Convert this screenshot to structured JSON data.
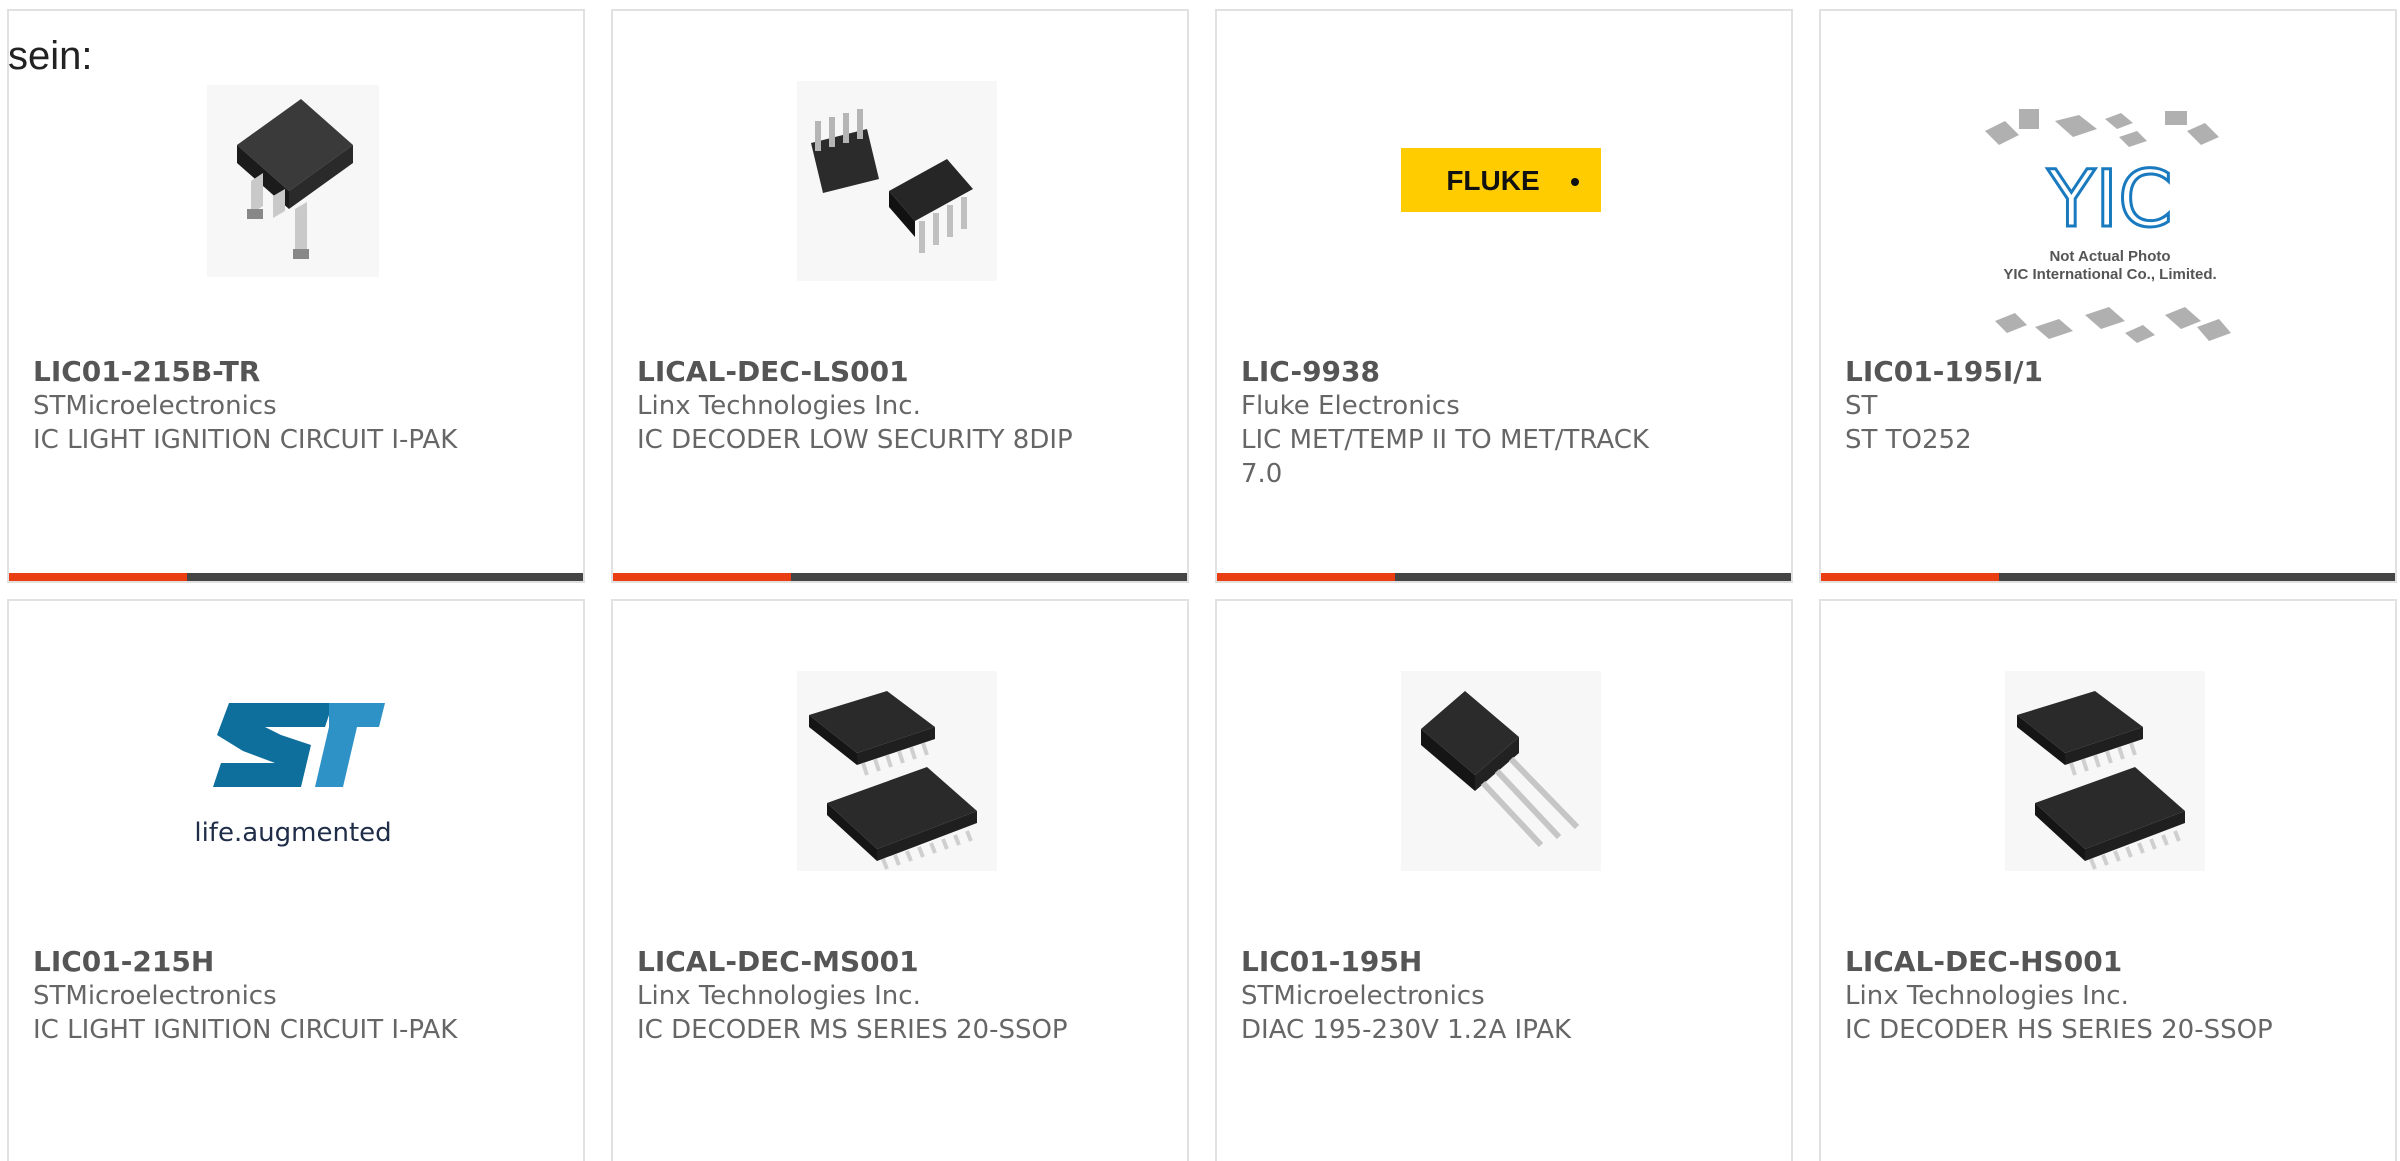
{
  "intro_text": "sein:",
  "colors": {
    "accent": "#e83e12",
    "track": "#444444",
    "card_border": "#e1e1e1",
    "text": "#666666"
  },
  "products": [
    {
      "part_number": "LIC01-215B-TR",
      "manufacturer": "STMicroelectronics",
      "description": "IC LIGHT IGNITION CIRCUIT I-PAK",
      "image": "dpak-package-icon",
      "progress_fraction": 0.31
    },
    {
      "part_number": "LICAL-DEC-LS001",
      "manufacturer": "Linx Technologies Inc.",
      "description": "IC DECODER LOW SECURITY 8DIP",
      "image": "dip-package-icon",
      "progress_fraction": 0.31
    },
    {
      "part_number": "LIC-9938",
      "manufacturer": "Fluke Electronics",
      "description": "LIC MET/TEMP II TO MET/TRACK 7.0",
      "image": "fluke-logo",
      "image_text": "FLUKE",
      "progress_fraction": 0.31
    },
    {
      "part_number": "LIC01-195I/1",
      "manufacturer": "ST",
      "description": "ST TO252",
      "image": "yic-placeholder",
      "image_text_line1": "Not Actual Photo",
      "image_text_line2": "YIC International Co., Limited.",
      "image_logo": "YIC",
      "progress_fraction": 0.31
    },
    {
      "part_number": "LIC01-215H",
      "manufacturer": "STMicroelectronics",
      "description": "IC LIGHT IGNITION CIRCUIT I-PAK",
      "image": "st-logo",
      "image_text": "life.augmented"
    },
    {
      "part_number": "LICAL-DEC-MS001",
      "manufacturer": "Linx Technologies Inc.",
      "description": "IC DECODER MS SERIES 20-SSOP",
      "image": "ssop-package-icon"
    },
    {
      "part_number": "LIC01-195H",
      "manufacturer": "STMicroelectronics",
      "description": "DIAC 195-230V 1.2A IPAK",
      "image": "ipak-package-icon"
    },
    {
      "part_number": "LICAL-DEC-HS001",
      "manufacturer": "Linx Technologies Inc.",
      "description": "IC DECODER HS SERIES 20-SSOP",
      "image": "ssop-package-icon"
    }
  ]
}
